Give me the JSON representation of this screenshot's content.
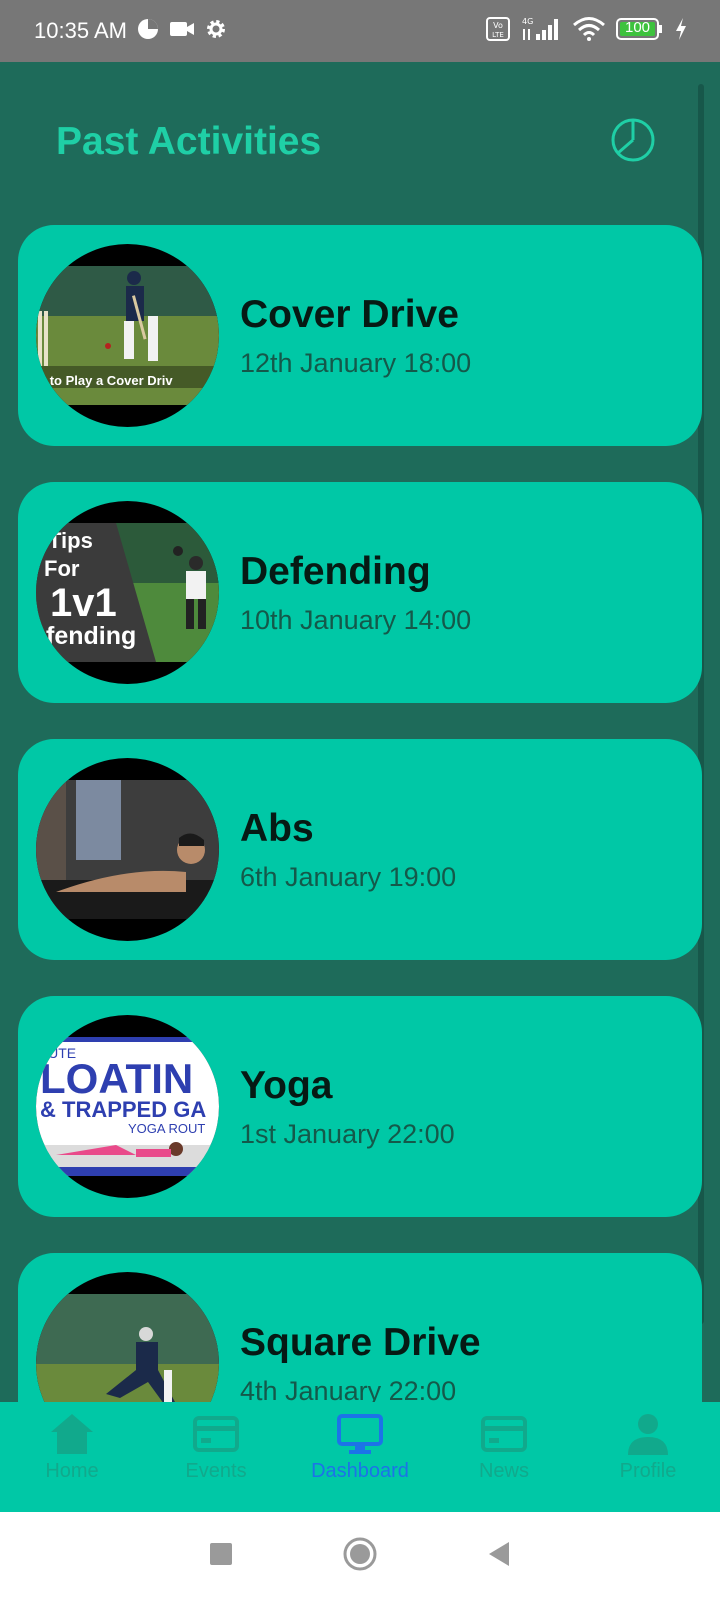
{
  "status_bar": {
    "time": "10:35 AM",
    "battery": "100",
    "icons": [
      "pie-icon",
      "video-icon",
      "gear-icon",
      "volte-icon",
      "signal-icon",
      "wifi-icon",
      "battery-icon",
      "charging-icon"
    ]
  },
  "header": {
    "title": "Past Activities",
    "action_icon": "history-icon"
  },
  "activities": [
    {
      "title": "Cover Drive",
      "date": "12th January 18:00",
      "thumb_text": "w to Play a Cover Driv"
    },
    {
      "title": "Defending",
      "date": "10th January 14:00",
      "thumb_text_1": "Tips",
      "thumb_text_2": "For",
      "thumb_text_3": "1v1",
      "thumb_text_4": "fending"
    },
    {
      "title": "Abs",
      "date": "6th January 19:00"
    },
    {
      "title": "Yoga",
      "date": "1st January 22:00",
      "thumb_text_1": "NUTE",
      "thumb_text_2": "LOATIN",
      "thumb_text_3": "& TRAPPED GA",
      "thumb_text_4": "YOGA ROUT"
    },
    {
      "title": "Square Drive",
      "date": "4th January 22:00"
    }
  ],
  "bottom_nav": {
    "items": [
      {
        "label": "Home",
        "icon": "home-icon"
      },
      {
        "label": "Events",
        "icon": "card-icon"
      },
      {
        "label": "Dashboard",
        "icon": "monitor-icon"
      },
      {
        "label": "News",
        "icon": "card-icon"
      },
      {
        "label": "Profile",
        "icon": "person-icon"
      }
    ],
    "active": "Dashboard"
  },
  "colors": {
    "background": "#1e6b5a",
    "card": "#00c8a6",
    "title_accent": "#1fcfa6",
    "nav_active": "#1c73e8"
  }
}
